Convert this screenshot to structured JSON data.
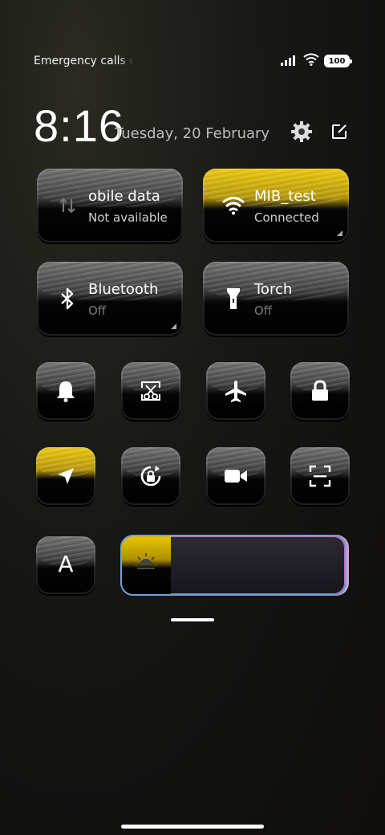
{
  "status_bar": {
    "carrier_text": "Emergency calls o",
    "battery_level": "100"
  },
  "header": {
    "time": "8:16",
    "date": "Tuesday, 20 February"
  },
  "large_tiles": [
    {
      "id": "mobile-data",
      "title": "obile data",
      "subtitle": "Not available",
      "active": false
    },
    {
      "id": "wifi",
      "title": "MIB_test",
      "subtitle": "Connected",
      "active": true
    },
    {
      "id": "bluetooth",
      "title": "Bluetooth",
      "subtitle": "Off",
      "active": false
    },
    {
      "id": "torch",
      "title": "Torch",
      "subtitle": "Off",
      "active": false
    }
  ],
  "small_tiles": [
    {
      "icon": "bell-icon",
      "active": false
    },
    {
      "icon": "screenshot-icon",
      "active": false
    },
    {
      "icon": "airplane-icon",
      "active": false
    },
    {
      "icon": "lock-icon",
      "active": false
    },
    {
      "icon": "location-icon",
      "active": true
    },
    {
      "icon": "rotation-lock-icon",
      "active": false
    },
    {
      "icon": "video-camera-icon",
      "active": false
    },
    {
      "icon": "scan-icon",
      "active": false
    },
    {
      "icon": "font-icon",
      "label": "A",
      "active": false
    }
  ],
  "brightness": {
    "level": 0.22
  },
  "colors": {
    "accent": "#e9c400",
    "slider_border": "#6fa2d8"
  }
}
